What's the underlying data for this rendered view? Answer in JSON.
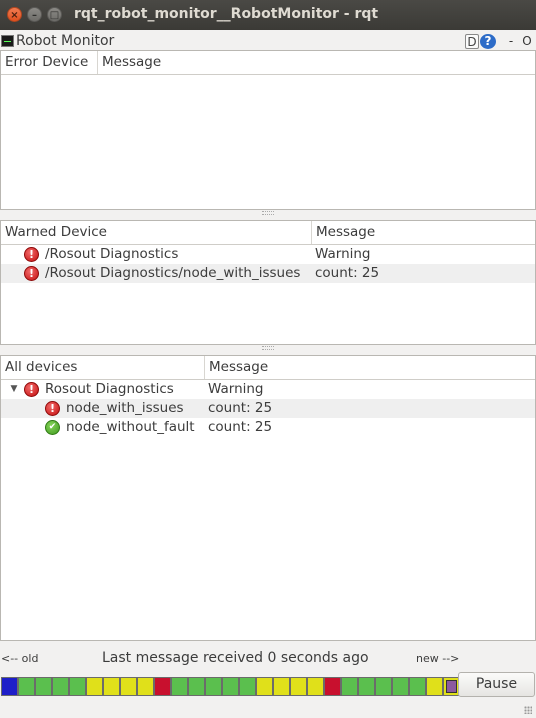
{
  "window": {
    "title": "rqt_robot_monitor__RobotMonitor - rqt",
    "close_glyph": "×",
    "minimize_glyph": "–",
    "maximize_glyph": "□"
  },
  "plugin": {
    "title": "Robot Monitor",
    "d_button": "D",
    "help_button": "?",
    "minimize": "-",
    "close": "O"
  },
  "error_table": {
    "headers": [
      "Error Device",
      "Message"
    ],
    "rows": []
  },
  "warn_table": {
    "headers": [
      "Warned Device",
      "Message"
    ],
    "rows": [
      {
        "device": "/Rosout Diagnostics",
        "message": "Warning",
        "status": "error"
      },
      {
        "device": "/Rosout Diagnostics/node_with_issues",
        "message": "count: 25",
        "status": "error"
      }
    ]
  },
  "all_table": {
    "headers": [
      "All devices",
      "Message"
    ],
    "rows": [
      {
        "device": "Rosout Diagnostics",
        "message": "Warning",
        "status": "error",
        "level": 0,
        "expanded": true
      },
      {
        "device": "node_with_issues",
        "message": "count: 25",
        "status": "error",
        "level": 1
      },
      {
        "device": "node_without_fault",
        "message": "count: 25",
        "status": "ok",
        "level": 1
      }
    ]
  },
  "status": {
    "old_label": "<-- old",
    "message": "Last message received 0 seconds ago",
    "new_label": "new -->"
  },
  "timeline": {
    "colors": {
      "blue": "#1e1ec8",
      "green": "#5bbf4e",
      "yellow": "#e0e01a",
      "red": "#c8102e",
      "purple": "#8c5aa0"
    },
    "cells": [
      "blue",
      "green",
      "green",
      "green",
      "green",
      "yellow",
      "yellow",
      "yellow",
      "yellow",
      "red",
      "green",
      "green",
      "green",
      "green",
      "green",
      "yellow",
      "yellow",
      "yellow",
      "yellow",
      "red",
      "green",
      "green",
      "green",
      "green",
      "green",
      "yellow",
      "selected"
    ]
  },
  "pause_button": "Pause"
}
